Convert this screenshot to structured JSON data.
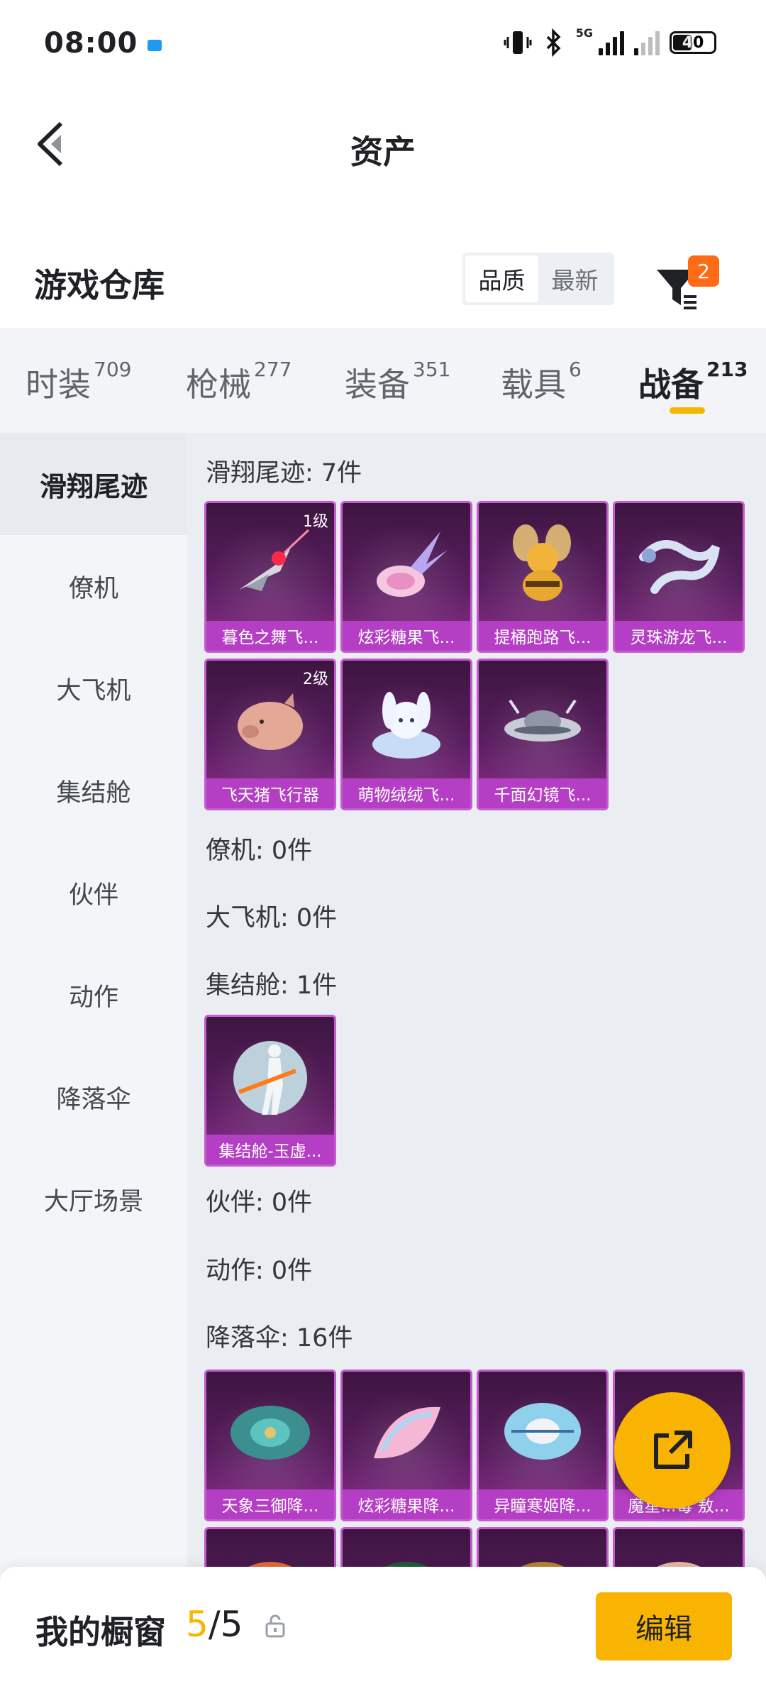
{
  "status_bar": {
    "time": "08:00",
    "network": "5G",
    "battery": "40"
  },
  "header": {
    "title": "资产"
  },
  "warehouse": {
    "title": "游戏仓库",
    "sort_options": [
      "品质",
      "最新"
    ],
    "filter_badge": "2"
  },
  "tabs": [
    {
      "label": "时装",
      "count": "709"
    },
    {
      "label": "枪械",
      "count": "277"
    },
    {
      "label": "装备",
      "count": "351"
    },
    {
      "label": "载具",
      "count": "6"
    },
    {
      "label": "战备",
      "count": "213"
    }
  ],
  "sidebar": {
    "items": [
      "滑翔尾迹",
      "僚机",
      "大飞机",
      "集结舱",
      "伙伴",
      "动作",
      "降落伞",
      "大厅场景"
    ]
  },
  "sections": {
    "glide_trails": {
      "title": "滑翔尾迹: 7件",
      "items": [
        {
          "name": "暮色之舞飞...",
          "level": "1级",
          "icon": "winged-blade-icon"
        },
        {
          "name": "炫彩糖果飞...",
          "level": "",
          "icon": "candy-glider-icon"
        },
        {
          "name": "提桶跑路飞...",
          "level": "",
          "icon": "bee-bucket-icon"
        },
        {
          "name": "灵珠游龙飞...",
          "level": "",
          "icon": "dragon-icon"
        },
        {
          "name": "飞天猪飞行器",
          "level": "2级",
          "icon": "flying-pig-icon"
        },
        {
          "name": "萌物绒绒飞...",
          "level": "",
          "icon": "bunny-plush-icon"
        },
        {
          "name": "千面幻镜飞...",
          "level": "",
          "icon": "ufo-icon"
        }
      ]
    },
    "wingman": {
      "title": "僚机: 0件"
    },
    "big_plane": {
      "title": "大飞机: 0件"
    },
    "assembly_pod": {
      "title": "集结舱: 1件",
      "items": [
        {
          "name": "集结舱-玉虚...",
          "icon": "hero-figure-icon"
        }
      ]
    },
    "partner": {
      "title": "伙伴: 0件"
    },
    "action": {
      "title": "动作: 0件"
    },
    "parachute": {
      "title": "降落伞: 16件",
      "items": [
        {
          "name": "天象三御降...",
          "icon": "parachute-teal-icon"
        },
        {
          "name": "炫彩糖果降...",
          "icon": "parachute-candy-icon"
        },
        {
          "name": "异瞳寒姬降...",
          "icon": "parachute-blue-icon"
        },
        {
          "name": "魔星...毒 敖...",
          "icon": "parachute-dark-icon"
        }
      ]
    }
  },
  "showcase": {
    "label": "我的橱窗",
    "current": "5",
    "separator": "/",
    "total": "5",
    "edit": "编辑"
  },
  "colors": {
    "accent": "#f8b400",
    "badge": "#ff6a14",
    "card_purple": "#b53fc4"
  }
}
